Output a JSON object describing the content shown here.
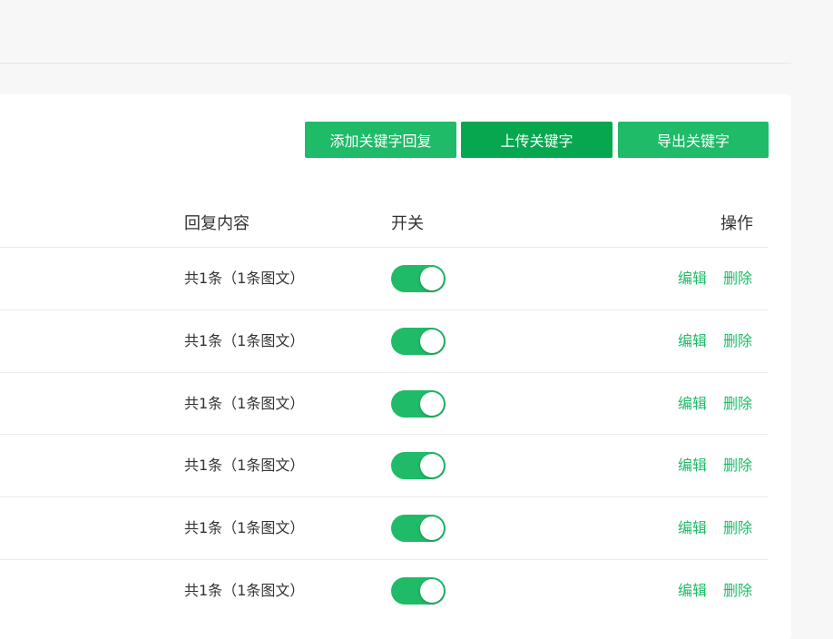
{
  "toolbar": {
    "add_label": "添加关键字回复",
    "upload_label": "上传关键字",
    "export_label": "导出关键字"
  },
  "table": {
    "headers": {
      "content": "回复内容",
      "switch": "开关",
      "action": "操作"
    },
    "rows": [
      {
        "content": "共1条（1条图文）",
        "enabled": true,
        "edit": "编辑",
        "delete": "删除"
      },
      {
        "content": "共1条（1条图文）",
        "enabled": true,
        "edit": "编辑",
        "delete": "删除"
      },
      {
        "content": "共1条（1条图文）",
        "enabled": true,
        "edit": "编辑",
        "delete": "删除"
      },
      {
        "content": "共1条（1条图文）",
        "enabled": true,
        "edit": "编辑",
        "delete": "删除"
      },
      {
        "content": "共1条（1条图文）",
        "enabled": true,
        "edit": "编辑",
        "delete": "删除"
      },
      {
        "content": "共1条（1条图文）",
        "enabled": true,
        "edit": "编辑",
        "delete": "删除"
      }
    ]
  },
  "colors": {
    "accent": "#1fbb68",
    "accent_dark": "#07a750"
  }
}
